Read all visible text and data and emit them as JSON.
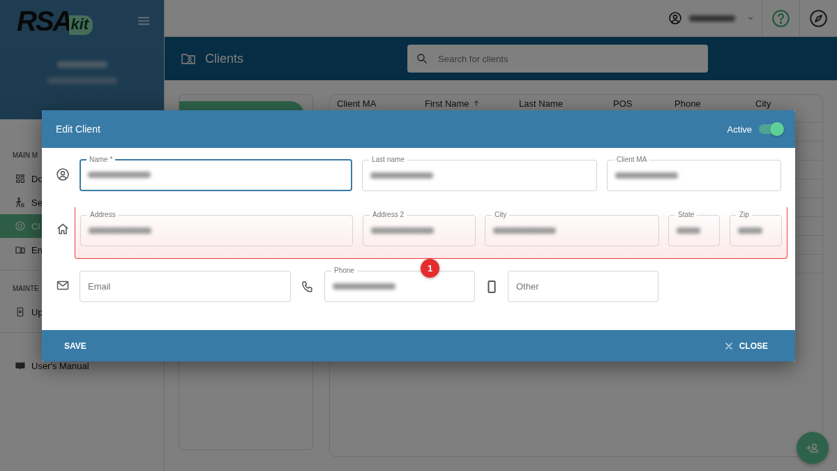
{
  "logo": {
    "text": "RSA",
    "accent": "kit"
  },
  "sidebar": {
    "profile_hidden": true,
    "sections": [
      {
        "title": "MAIN M",
        "items": [
          {
            "label": "Do",
            "selected": false
          },
          {
            "label": "Se",
            "selected": false
          },
          {
            "label": "Cl",
            "selected": true
          },
          {
            "label": "En",
            "selected": false
          }
        ]
      },
      {
        "title": "MAINTE",
        "items": [
          {
            "label": "Up",
            "selected": false
          }
        ]
      }
    ],
    "footer_items": [
      {
        "label": "User's Manual",
        "selected": false
      }
    ]
  },
  "topbar": {
    "user_hidden": true
  },
  "page": {
    "title": "Clients",
    "search": {
      "placeholder": "Search for clients"
    }
  },
  "table": {
    "columns": [
      {
        "label": "Client MA",
        "sorted": false
      },
      {
        "label": "First Name",
        "sorted": true
      },
      {
        "label": "Last Name",
        "sorted": false
      },
      {
        "label": "POS",
        "sorted": false
      },
      {
        "label": "Phone",
        "sorted": false
      },
      {
        "label": "City",
        "sorted": false
      }
    ]
  },
  "dialog": {
    "title": "Edit Client",
    "active": {
      "label": "Active",
      "on": true
    },
    "rows": [
      {
        "highlighted": false,
        "fields": [
          {
            "label": "Name *",
            "value_hidden": true,
            "focused": true,
            "icon": true
          },
          {
            "label": "Last name",
            "value_hidden": true,
            "focused": false,
            "icon": false
          },
          {
            "label": "Client MA",
            "value_hidden": true,
            "focused": false,
            "icon": false
          }
        ]
      },
      {
        "highlighted": true,
        "badge": "1",
        "fields": [
          {
            "label": "Address",
            "value_hidden": true,
            "focused": false,
            "icon": true
          },
          {
            "label": "Address 2",
            "value_hidden": true,
            "focused": false,
            "icon": false
          },
          {
            "label": "City",
            "value_hidden": true,
            "focused": false,
            "icon": false
          },
          {
            "label": "State",
            "value_hidden": true,
            "focused": false,
            "icon": false
          },
          {
            "label": "Zip",
            "value_hidden": true,
            "focused": false,
            "icon": false
          }
        ]
      },
      {
        "highlighted": false,
        "fields": [
          {
            "placeholder": "Email",
            "focused": false,
            "icon": true
          },
          {
            "label": "Phone",
            "value_hidden": true,
            "focused": false,
            "icon": true
          },
          {
            "placeholder": "Other",
            "focused": false,
            "icon": true
          }
        ]
      }
    ],
    "buttons": {
      "save": "SAVE",
      "close": "CLOSE"
    }
  }
}
